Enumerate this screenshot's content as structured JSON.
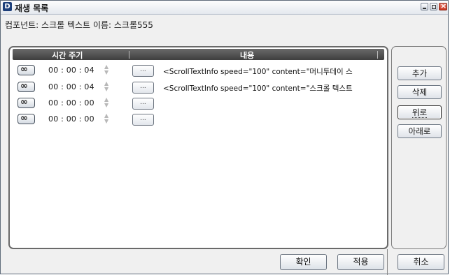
{
  "window": {
    "icon_letter": "D",
    "title": "재생 목록"
  },
  "info": {
    "component_label": "컴포넌트:",
    "component_value": "스크롤 텍스트",
    "name_label": "이름:",
    "name_value": "스크롤555"
  },
  "list": {
    "headers": {
      "time": "시간 주기",
      "content": "내용"
    },
    "rows": [
      {
        "repeat_icon": "infinity-icon",
        "time": "00 : 00 : 04",
        "dots": "...",
        "content": "<ScrollTextInfo speed=\"100\" content=\"머니투데이 스"
      },
      {
        "repeat_icon": "infinity-icon",
        "time": "00 : 00 : 04",
        "dots": "...",
        "content": "<ScrollTextInfo speed=\"100\" content=\"스크롤 텍스트"
      },
      {
        "repeat_icon": "infinity-icon",
        "time": "00 : 00 : 00",
        "dots": "...",
        "content": ""
      },
      {
        "repeat_icon": "infinity-icon",
        "time": "00 : 00 : 00",
        "dots": "...",
        "content": ""
      }
    ]
  },
  "side_buttons": {
    "add": "추가",
    "delete": "삭제",
    "up": "위로",
    "down": "아래로"
  },
  "bottom_buttons": {
    "ok": "확인",
    "apply": "적용",
    "cancel": "취소"
  }
}
